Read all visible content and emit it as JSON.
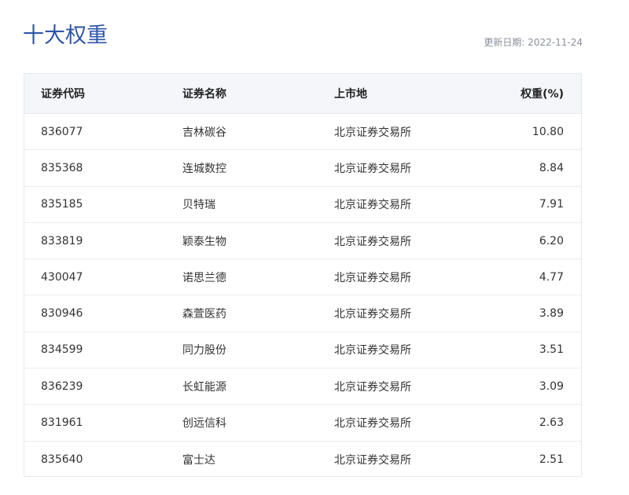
{
  "header": {
    "title": "十大权重",
    "update_date": "更新日期: 2022-11-24"
  },
  "table": {
    "columns": [
      "证券代码",
      "证券名称",
      "上市地",
      "权重(%)"
    ],
    "rows": [
      {
        "code": "836077",
        "name": "吉林碳谷",
        "place": "北京证券交易所",
        "weight": "10.80"
      },
      {
        "code": "835368",
        "name": "连城数控",
        "place": "北京证券交易所",
        "weight": "8.84"
      },
      {
        "code": "835185",
        "name": "贝特瑞",
        "place": "北京证券交易所",
        "weight": "7.91"
      },
      {
        "code": "833819",
        "name": "颖泰生物",
        "place": "北京证券交易所",
        "weight": "6.20"
      },
      {
        "code": "430047",
        "name": "诺思兰德",
        "place": "北京证券交易所",
        "weight": "4.77"
      },
      {
        "code": "830946",
        "name": "森萱医药",
        "place": "北京证券交易所",
        "weight": "3.89"
      },
      {
        "code": "834599",
        "name": "同力股份",
        "place": "北京证券交易所",
        "weight": "3.51"
      },
      {
        "code": "836239",
        "name": "长虹能源",
        "place": "北京证券交易所",
        "weight": "3.09"
      },
      {
        "code": "831961",
        "name": "创远信科",
        "place": "北京证券交易所",
        "weight": "2.63"
      },
      {
        "code": "835640",
        "name": "富士达",
        "place": "北京证券交易所",
        "weight": "2.51"
      }
    ]
  }
}
